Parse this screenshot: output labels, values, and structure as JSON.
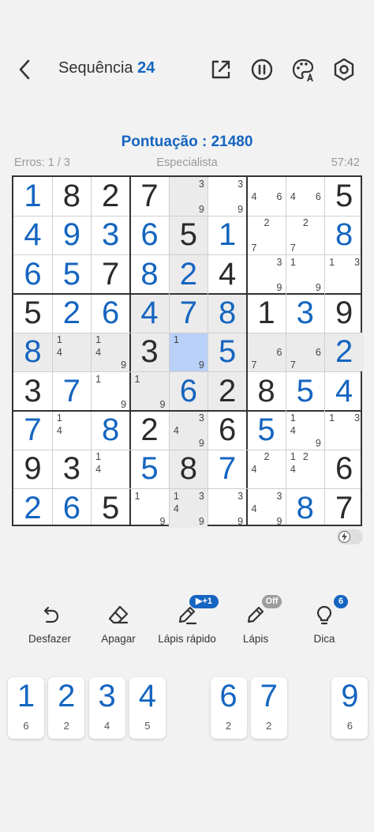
{
  "header": {
    "title": "Sequência",
    "level": "24"
  },
  "stats": {
    "score": "Pontuação : 21480",
    "errors": "Erros: 1 / 3",
    "difficulty": "Especialista",
    "time": "57:42"
  },
  "board": {
    "selected": [
      4,
      4
    ],
    "cells": [
      [
        {
          "v": "1",
          "u": 1
        },
        {
          "v": "8"
        },
        {
          "v": "2"
        },
        {
          "v": "7"
        },
        {
          "n": [
            3,
            9
          ]
        },
        {
          "n": [
            3,
            9
          ]
        },
        {
          "n": [
            4,
            6
          ]
        },
        {
          "n": [
            4,
            6
          ]
        },
        {
          "v": "5"
        }
      ],
      [
        {
          "v": "4",
          "u": 1
        },
        {
          "v": "9",
          "u": 1
        },
        {
          "v": "3",
          "u": 1
        },
        {
          "v": "6",
          "u": 1
        },
        {
          "v": "5"
        },
        {
          "v": "1",
          "u": 1
        },
        {
          "n": [
            2,
            7
          ]
        },
        {
          "n": [
            2,
            7
          ]
        },
        {
          "v": "8",
          "u": 1
        }
      ],
      [
        {
          "v": "6",
          "u": 1
        },
        {
          "v": "5",
          "u": 1
        },
        {
          "v": "7"
        },
        {
          "v": "8",
          "u": 1
        },
        {
          "v": "2",
          "u": 1
        },
        {
          "v": "4"
        },
        {
          "n": [
            3,
            9
          ]
        },
        {
          "n": [
            1,
            9
          ]
        },
        {
          "n": [
            1,
            3
          ]
        }
      ],
      [
        {
          "v": "5"
        },
        {
          "v": "2",
          "u": 1
        },
        {
          "v": "6",
          "u": 1
        },
        {
          "v": "4",
          "u": 1
        },
        {
          "v": "7",
          "u": 1
        },
        {
          "v": "8",
          "u": 1
        },
        {
          "v": "1"
        },
        {
          "v": "3",
          "u": 1
        },
        {
          "v": "9"
        }
      ],
      [
        {
          "v": "8",
          "u": 1
        },
        {
          "n": [
            1,
            4
          ]
        },
        {
          "n": [
            1,
            4,
            9
          ]
        },
        {
          "v": "3"
        },
        {
          "n": [
            1,
            9
          ]
        },
        {
          "v": "5",
          "u": 1
        },
        {
          "n": [
            6,
            7
          ]
        },
        {
          "n": [
            6,
            7
          ]
        },
        {
          "v": "2",
          "u": 1
        }
      ],
      [
        {
          "v": "3"
        },
        {
          "v": "7",
          "u": 1
        },
        {
          "n": [
            1,
            9
          ]
        },
        {
          "n": [
            1,
            9
          ]
        },
        {
          "v": "6",
          "u": 1
        },
        {
          "v": "2"
        },
        {
          "v": "8"
        },
        {
          "v": "5",
          "u": 1
        },
        {
          "v": "4",
          "u": 1
        }
      ],
      [
        {
          "v": "7",
          "u": 1
        },
        {
          "n": [
            1,
            4
          ]
        },
        {
          "v": "8",
          "u": 1
        },
        {
          "v": "2"
        },
        {
          "n": [
            3,
            4,
            9
          ]
        },
        {
          "v": "6"
        },
        {
          "v": "5",
          "u": 1
        },
        {
          "n": [
            1,
            4,
            9
          ]
        },
        {
          "n": [
            1,
            3
          ]
        }
      ],
      [
        {
          "v": "9"
        },
        {
          "v": "3"
        },
        {
          "n": [
            1,
            4
          ]
        },
        {
          "v": "5",
          "u": 1
        },
        {
          "v": "8"
        },
        {
          "v": "7",
          "u": 1
        },
        {
          "n": [
            2,
            4
          ]
        },
        {
          "n": [
            1,
            2,
            4
          ]
        },
        {
          "v": "6"
        }
      ],
      [
        {
          "v": "2",
          "u": 1
        },
        {
          "v": "6",
          "u": 1
        },
        {
          "v": "5"
        },
        {
          "n": [
            1,
            9
          ]
        },
        {
          "n": [
            1,
            3,
            4,
            9
          ]
        },
        {
          "n": [
            3,
            9
          ]
        },
        {
          "n": [
            3,
            4,
            9
          ]
        },
        {
          "v": "8",
          "u": 1
        },
        {
          "v": "7"
        }
      ]
    ]
  },
  "tools": {
    "undo": "Desfazer",
    "erase": "Apagar",
    "quick_pencil": "Lápis rápido",
    "quick_pencil_badge": "+1",
    "pencil": "Lápis",
    "pencil_badge": "Off",
    "hint": "Dica",
    "hint_badge": "6"
  },
  "keypad": [
    {
      "digit": "1",
      "count": "6"
    },
    {
      "digit": "2",
      "count": "2"
    },
    {
      "digit": "3",
      "count": "4"
    },
    {
      "digit": "4",
      "count": "5"
    },
    {
      "digit": "6",
      "count": "2"
    },
    {
      "digit": "7",
      "count": "2"
    },
    {
      "digit": "9",
      "count": "6"
    }
  ],
  "colors": {
    "accent": "#1565c0",
    "selected_cell": "#b9d0f8",
    "shaded_cell": "#ebebeb",
    "badge_gray": "#9e9e9e"
  }
}
